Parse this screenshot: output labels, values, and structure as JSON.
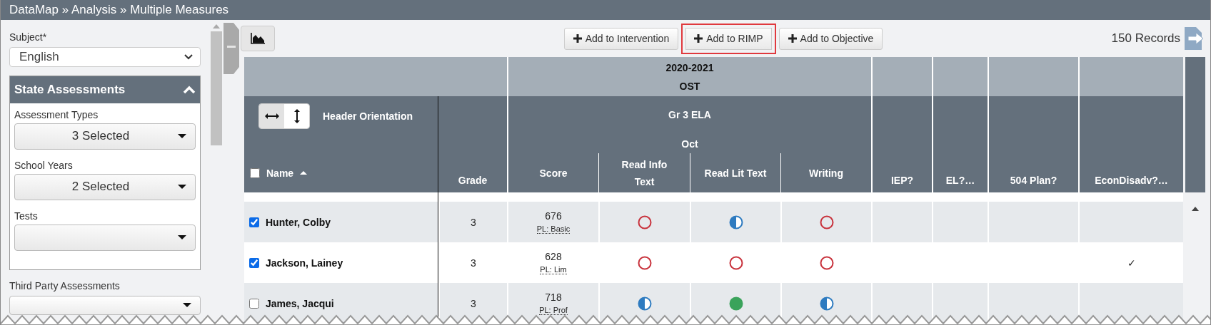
{
  "breadcrumb": "DataMap » Analysis » Multiple Measures",
  "filters": {
    "subject_label": "Subject*",
    "subject_value": "English",
    "state_assessments": {
      "title": "State Assessments",
      "expanded": true,
      "fields": [
        {
          "label": "Assessment Types",
          "value": "3 Selected"
        },
        {
          "label": "School Years",
          "value": "2 Selected"
        },
        {
          "label": "Tests"
        }
      ]
    },
    "third_party_label": "Third Party Assessments"
  },
  "toolbar": {
    "buttons": [
      {
        "label": "Add to Intervention",
        "highlighted": false
      },
      {
        "label": "Add to RIMP",
        "highlighted": true
      },
      {
        "label": "Add to Objective",
        "highlighted": false
      }
    ],
    "records": "150 Records"
  },
  "table": {
    "year": "2020-2021",
    "test": "OST",
    "subject": "Gr 3 ELA",
    "month": "Oct",
    "orientation_label": "Header Orientation",
    "horizontal": true,
    "select_all": false,
    "columns": [
      "Name",
      "Grade",
      "Score",
      "Read Info Text",
      "Read Lit Text",
      "Writing",
      "IEP?",
      "EL?…",
      "504 Plan?",
      "EconDisadv?…"
    ],
    "rows": [
      {
        "cells": [
          {
            "kind": "name",
            "text": "Hunter, Colby",
            "checked": true
          },
          {
            "kind": "text",
            "text": "3"
          },
          {
            "kind": "score",
            "score": "676",
            "pl": "PL: Basic"
          },
          {
            "kind": "empty_circle"
          },
          {
            "kind": "half_circle"
          },
          {
            "kind": "empty_circle"
          },
          {
            "kind": "blank"
          },
          {
            "kind": "blank"
          },
          {
            "kind": "blank"
          },
          {
            "kind": "blank"
          }
        ]
      },
      {
        "cells": [
          {
            "kind": "name",
            "text": "Jackson, Lainey",
            "checked": true
          },
          {
            "kind": "text",
            "text": "3"
          },
          {
            "kind": "score",
            "score": "628",
            "pl": "PL: Lim"
          },
          {
            "kind": "empty_circle"
          },
          {
            "kind": "empty_circle"
          },
          {
            "kind": "empty_circle"
          },
          {
            "kind": "blank"
          },
          {
            "kind": "blank"
          },
          {
            "kind": "blank"
          },
          {
            "kind": "text",
            "text": "✓"
          }
        ]
      },
      {
        "cells": [
          {
            "kind": "name",
            "text": "James, Jacqui",
            "checked": false
          },
          {
            "kind": "text",
            "text": "3"
          },
          {
            "kind": "score",
            "score": "718",
            "pl": "PL: Prof"
          },
          {
            "kind": "half_circle"
          },
          {
            "kind": "full_circle"
          },
          {
            "kind": "half_circle"
          },
          {
            "kind": "blank"
          },
          {
            "kind": "blank"
          },
          {
            "kind": "blank"
          },
          {
            "kind": "blank"
          }
        ]
      }
    ]
  }
}
